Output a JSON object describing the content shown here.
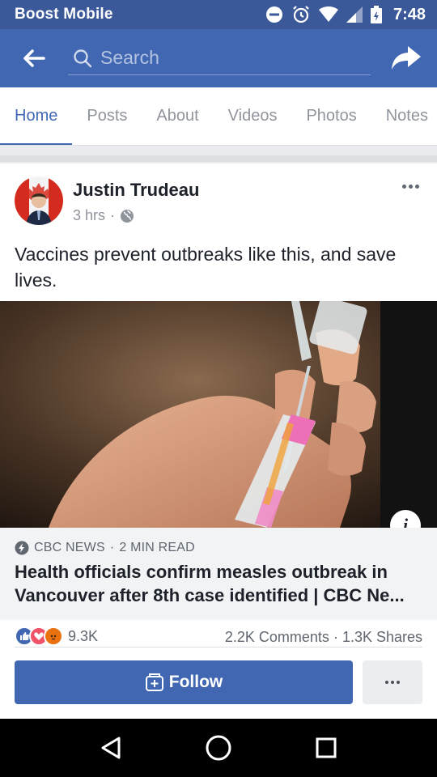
{
  "status_bar": {
    "carrier": "Boost Mobile",
    "time": "7:48"
  },
  "app_bar": {
    "search_placeholder": "Search"
  },
  "tabs": [
    {
      "label": "Home",
      "active": true
    },
    {
      "label": "Posts",
      "active": false
    },
    {
      "label": "About",
      "active": false
    },
    {
      "label": "Videos",
      "active": false
    },
    {
      "label": "Photos",
      "active": false
    },
    {
      "label": "Notes",
      "active": false
    }
  ],
  "post": {
    "author": "Justin Trudeau",
    "time_ago": "3 hrs",
    "privacy_icon": "globe-icon",
    "text": "Vaccines prevent outbreaks like this, and save lives.",
    "link": {
      "source": "CBC NEWS",
      "read_time": "2 MIN READ",
      "title": "Health officials confirm measles outbreak in Vancouver after 8th case identified | CBC Ne..."
    },
    "stats": {
      "reactions": "9.3K",
      "comments": "2.2K Comments",
      "shares": "1.3K Shares"
    },
    "follow_label": "Follow"
  },
  "colors": {
    "status_bar": "#3b5998",
    "app_bar": "#4267b2",
    "accent": "#4267b2",
    "text": "#1d2129",
    "muted": "#90949c"
  }
}
